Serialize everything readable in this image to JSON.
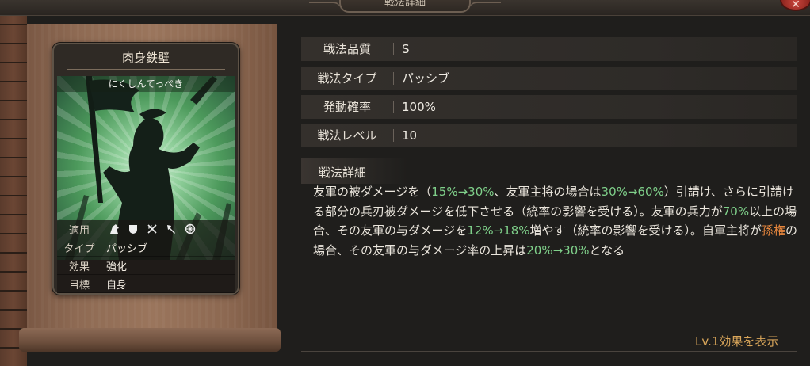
{
  "window": {
    "title": "戦法詳細",
    "close_icon": "close-icon"
  },
  "card": {
    "name": "肉身鉄壁",
    "reading": "にくしんてっぺき",
    "info": [
      {
        "label": "適用",
        "icons": [
          "cavalry-icon",
          "shield-icon",
          "crossed-bows-icon",
          "spear-icon",
          "wheel-icon"
        ]
      },
      {
        "label": "タイプ",
        "value": "パッシブ"
      },
      {
        "label": "効果",
        "value": "強化"
      },
      {
        "label": "目標",
        "value": "自身"
      }
    ]
  },
  "stats": [
    {
      "label": "戦法品質",
      "value": "S"
    },
    {
      "label": "戦法タイプ",
      "value": "パッシブ"
    },
    {
      "label": "発動確率",
      "value": "100%"
    },
    {
      "label": "戦法レベル",
      "value": "10"
    }
  ],
  "detail": {
    "heading": "戦法詳細",
    "segments": [
      {
        "text": "友軍の被ダメージを（",
        "color": "normal"
      },
      {
        "text": "15%→30%",
        "color": "green"
      },
      {
        "text": "、友軍主将の場合は",
        "color": "normal"
      },
      {
        "text": "30%→60%",
        "color": "green"
      },
      {
        "text": "）引請け、さらに引請ける部分の兵刃被ダメージを低下させる（統率の影響を受ける）。友軍の兵力が",
        "color": "normal"
      },
      {
        "text": "70%",
        "color": "green"
      },
      {
        "text": "以上の場合、その友軍の与ダメージを",
        "color": "normal"
      },
      {
        "text": "12%→18%",
        "color": "green"
      },
      {
        "text": "増やす（統率の影響を受ける）。自軍主将が",
        "color": "normal"
      },
      {
        "text": "孫権",
        "color": "orange"
      },
      {
        "text": "の場合、その友軍の与ダメージ率の上昇は",
        "color": "normal"
      },
      {
        "text": "20%→30%",
        "color": "green"
      },
      {
        "text": "となる",
        "color": "normal"
      }
    ]
  },
  "footer": {
    "lv1_link": "Lv.1効果を表示"
  },
  "colors": {
    "green": "#7fd08a",
    "orange": "#e8873d",
    "link": "#d9a65a"
  }
}
